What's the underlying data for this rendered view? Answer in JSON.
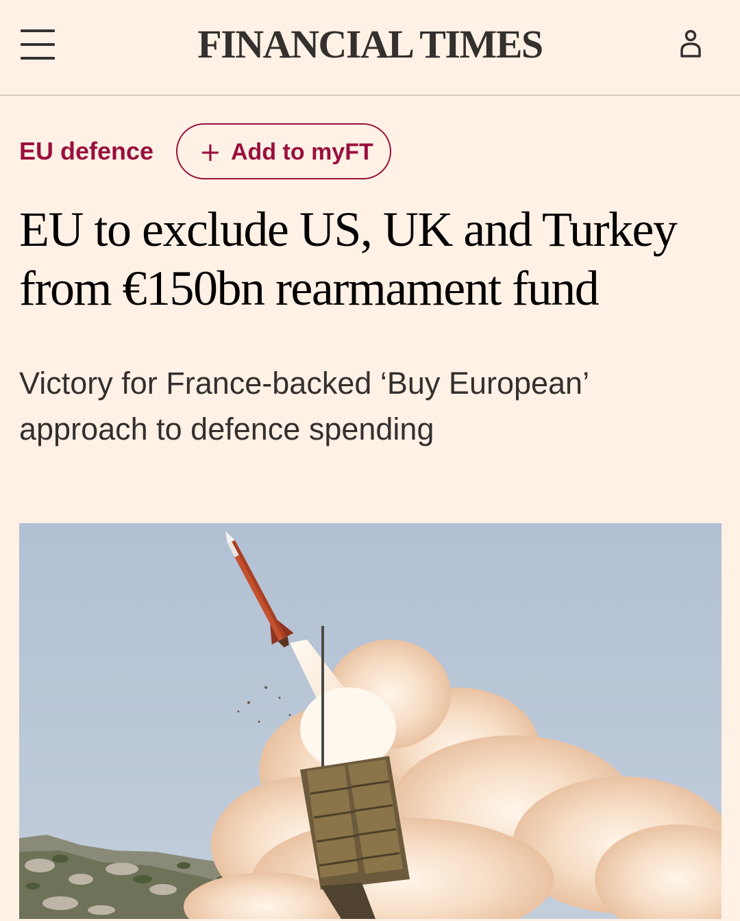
{
  "header": {
    "brand": "FINANCIAL TIMES",
    "menu_icon": "hamburger-menu-icon",
    "user_icon": "user-account-icon"
  },
  "article": {
    "topic": "EU defence",
    "myft_button": {
      "icon": "plus-icon",
      "label": "Add to myFT"
    },
    "headline": "EU to exclude US, UK and Turkey from €150bn rearmament fund",
    "standfirst": "Victory for France-backed ‘Buy European’ approach to defence spending",
    "image": {
      "subject": "missile-launch-photo"
    }
  },
  "colors": {
    "background": "#fff1e5",
    "text": "#33302e",
    "accent": "#990f3d",
    "divider": "#d9cdc2"
  }
}
